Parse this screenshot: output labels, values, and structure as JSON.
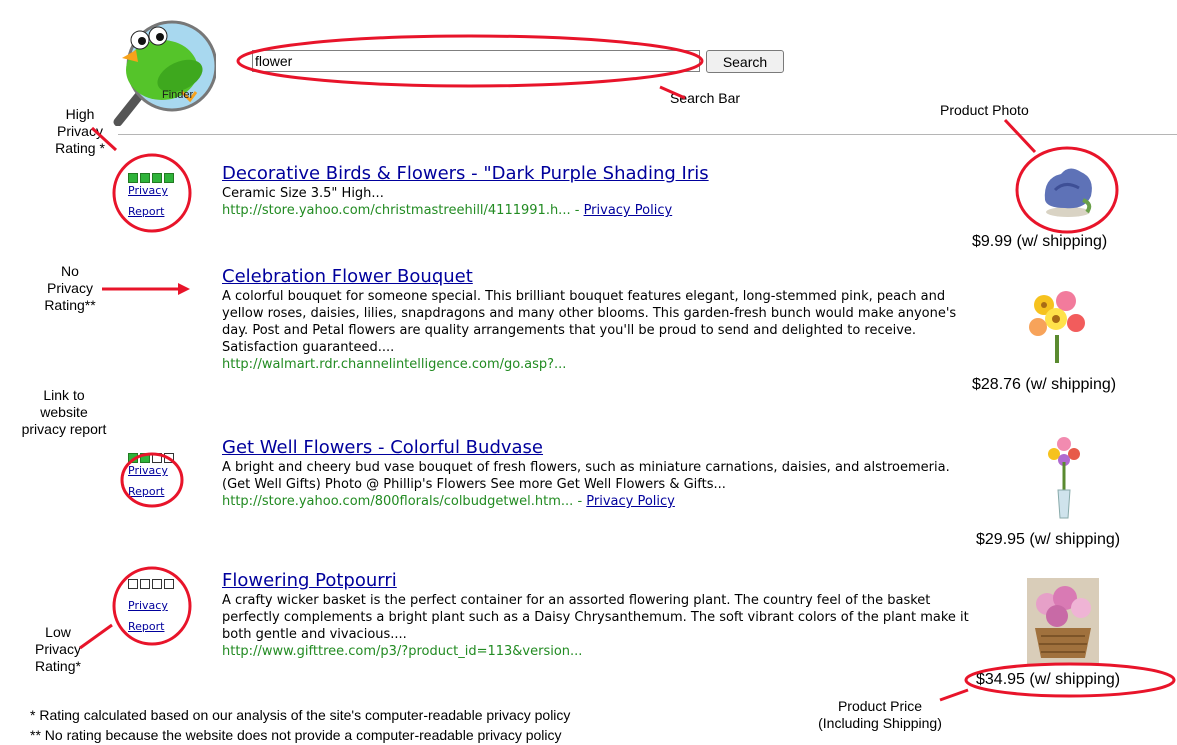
{
  "search": {
    "value": "flower",
    "button_label": "Search"
  },
  "logo": {
    "text": "Finder"
  },
  "annotations": {
    "search_bar": "Search Bar",
    "product_photo": "Product Photo",
    "high_rating": [
      "High",
      "Privacy",
      "Rating *"
    ],
    "no_rating": [
      "No",
      "Privacy",
      "Rating**"
    ],
    "link_report": [
      "Link to",
      "website",
      "privacy report"
    ],
    "low_rating": [
      "Low",
      "Privacy",
      "Rating*"
    ],
    "product_price": [
      "Product Price",
      "(Including Shipping)"
    ]
  },
  "privacy_links": {
    "line1": "Privacy",
    "line2": "Report"
  },
  "results": [
    {
      "title": "Decorative Birds & Flowers - \"Dark Purple Shading Iris",
      "desc": "Ceramic Size 3.5\" High...",
      "url": "http://store.yahoo.com/christmastreehill/4111991.h...",
      "policy_sep": " - ",
      "policy": "Privacy Policy",
      "rating": 4,
      "price": "$9.99 (w/ shipping)"
    },
    {
      "title": "Celebration Flower Bouquet",
      "desc": "A colorful bouquet for someone special. This brilliant bouquet features elegant, long-stemmed pink, peach and yellow roses, daisies, lilies, snapdragons and many other blooms. This garden-fresh bunch would make anyone's day. Post and Petal flowers are quality arrangements that you'll be proud to send and delighted to receive. Satisfaction guaranteed....",
      "url": "http://walmart.rdr.channelintelligence.com/go.asp?...",
      "price": "$28.76 (w/ shipping)"
    },
    {
      "title": "Get Well Flowers - Colorful Budvase",
      "desc": "A bright and cheery bud vase bouquet of fresh flowers, such as miniature carnations, daisies, and alstroemeria. (Get Well Gifts) Photo @ Phillip's Flowers See more Get Well Flowers & Gifts...",
      "url": "http://store.yahoo.com/800florals/colbudgetwel.htm...",
      "policy_sep": " - ",
      "policy": "Privacy Policy",
      "rating": 2,
      "price": "$29.95 (w/ shipping)"
    },
    {
      "title": "Flowering Potpourri",
      "desc": "A crafty wicker basket is the perfect container for an assorted flowering plant. The country feel of the basket perfectly complements a bright plant such as a Daisy Chrysanthemum. The soft vibrant colors of the plant make it both gentle and vivacious....",
      "url": "http://www.gifttree.com/p3/?product_id=113&version...",
      "rating": 0,
      "price": "$34.95 (w/ shipping)"
    }
  ],
  "footnotes": [
    "* Rating calculated based on our analysis of the site's computer-readable privacy policy",
    "** No rating because the website does not provide a computer-readable privacy policy"
  ],
  "colors": {
    "link": "#00009c",
    "url": "#228b22",
    "annotation": "#e8142a",
    "rating_on": "#2fb33a"
  }
}
